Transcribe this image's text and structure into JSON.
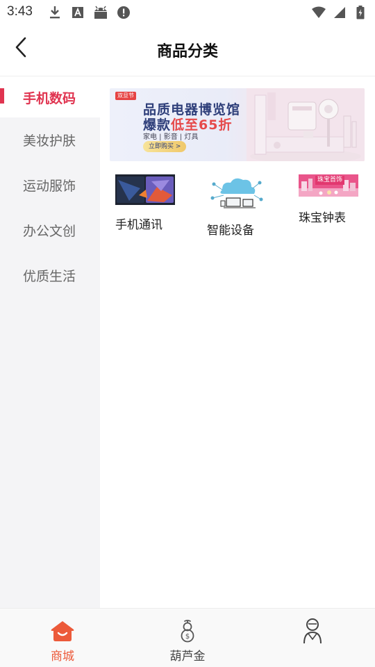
{
  "status_bar": {
    "time": "3:43",
    "left_icons": [
      "download-icon",
      "font-a-icon",
      "android-icon",
      "alert-icon"
    ],
    "right_icons": [
      "wifi-icon",
      "signal-icon",
      "battery-icon"
    ]
  },
  "header": {
    "title": "商品分类",
    "back_icon": "chevron-left-icon"
  },
  "sidebar": {
    "items": [
      {
        "label": "手机数码",
        "active": true
      },
      {
        "label": "美妆护肤",
        "active": false
      },
      {
        "label": "运动服饰",
        "active": false
      },
      {
        "label": "办公文创",
        "active": false
      },
      {
        "label": "优质生活",
        "active": false
      }
    ]
  },
  "banner": {
    "tag": "双旦节",
    "line1": "品质电器博览馆",
    "line2_prefix": "爆款",
    "line2_highlight": "低至65折",
    "subtitle": "家电 | 影音 | 灯具",
    "button": "立即购买 >"
  },
  "categories": [
    {
      "label": "手机通讯",
      "icon": "phone-image"
    },
    {
      "label": "智能设备",
      "icon": "smart-device-image"
    },
    {
      "label": "珠宝钟表",
      "icon": "jewelry-image",
      "image_text": "珠宝首饰"
    }
  ],
  "bottom_nav": {
    "tabs": [
      {
        "label": "商城",
        "icon": "home-icon",
        "active": true
      },
      {
        "label": "葫芦金",
        "icon": "gourd-icon",
        "active": false
      },
      {
        "label": "",
        "icon": "profile-icon",
        "active": false
      }
    ]
  },
  "colors": {
    "accent": "#e03450",
    "nav_active": "#ec5a3a",
    "sidebar_bg": "#f4f4f6"
  }
}
